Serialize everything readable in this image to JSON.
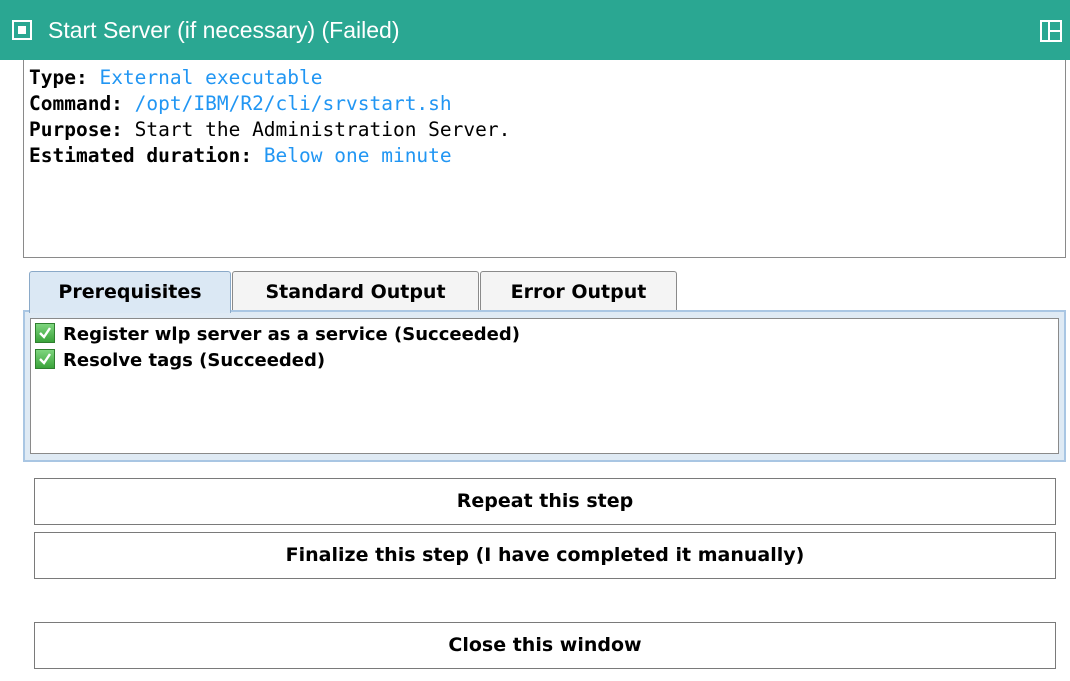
{
  "titlebar": {
    "title": "Start Server (if necessary)  (Failed)",
    "bg_color": "#2aa792",
    "icon": "window-menu-icon",
    "maximize_icon": "maximize-icon"
  },
  "info": {
    "type_key": "Type:",
    "type_value": "External executable",
    "command_key": "Command:",
    "command_value": "/opt/IBM/R2/cli/srvstart.sh",
    "purpose_key": "Purpose:",
    "purpose_value": "Start the Administration Server.",
    "duration_key": "Estimated duration:",
    "duration_value": "Below one minute",
    "value_color": "#2196f3"
  },
  "tabs": [
    {
      "label": "Prerequisites",
      "active": true
    },
    {
      "label": "Standard Output",
      "active": false
    },
    {
      "label": "Error Output",
      "active": false
    }
  ],
  "prerequisites": [
    {
      "label": "Register wlp server as a service  (Succeeded)",
      "icon": "check-icon"
    },
    {
      "label": "Resolve tags  (Succeeded)",
      "icon": "check-icon"
    }
  ],
  "buttons": {
    "repeat": "Repeat this step",
    "finalize": "Finalize this step (I have completed it manually)",
    "close": "Close this window"
  }
}
